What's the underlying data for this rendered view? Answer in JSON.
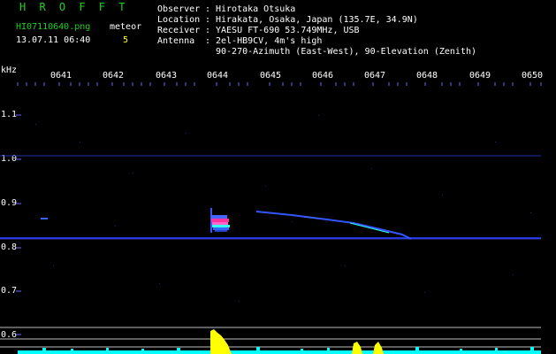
{
  "header": {
    "app_title": "H R O F F T",
    "filename": "HI07110640.png",
    "timestamp": "13.07.11 06:40",
    "meteor_label": "meteor",
    "meteor_count": "5",
    "info_lines": [
      {
        "key": "Observer",
        "value": "Hirotaka Otsuka"
      },
      {
        "key": "Location",
        "value": "Hirakata, Osaka, Japan (135.7E, 34.9N)"
      },
      {
        "key": "Receiver",
        "value": "YAESU FT-690 53.749MHz, USB"
      },
      {
        "key": "Antenna",
        "value": "2el-HB9CV, 4m's high"
      }
    ],
    "antenna_line2": "90-270-Azimuth (East-West), 90-Elevation (Zenith)"
  },
  "plot": {
    "y_unit": "kHz",
    "y_labels": [
      "1.1",
      "1.0",
      "0.9",
      "0.8",
      "0.7",
      "0.6"
    ],
    "x_labels": [
      "0641",
      "0642",
      "0643",
      "0644",
      "0645",
      "0646",
      "0647",
      "0648",
      "0649",
      "0650"
    ]
  },
  "colors": {
    "background": "#000000",
    "header_green": "#1fd11f",
    "label_white": "#ffffff",
    "meteor_yellow": "#ffff33",
    "carrier_blue": "#2233dd",
    "echo_magenta": "#ff3399",
    "echo_cyan": "#33ffee",
    "spectrum_yellow": "#ffff00",
    "spectrum_cyan": "#00ffff"
  }
}
